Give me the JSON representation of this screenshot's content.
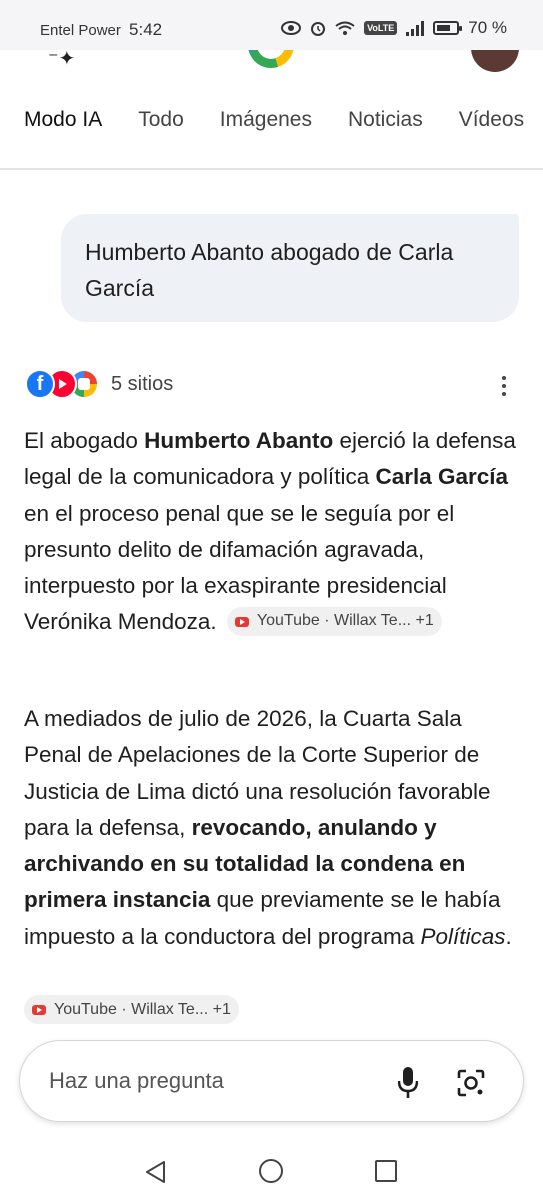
{
  "status": {
    "carrier": "Entel Power",
    "time": "5:42",
    "volte": "VoLTE",
    "battery": "70 %",
    "battery_level": 0.7
  },
  "tabs": [
    "Modo IA",
    "Todo",
    "Imágenes",
    "Noticias",
    "Vídeos"
  ],
  "query": "Humberto Abanto abogado de Carla García",
  "sources": {
    "label": "5 sitios",
    "icons": [
      "facebook-icon",
      "youtube-icon",
      "multi-source-icon"
    ]
  },
  "answer": {
    "p1": {
      "t1": "El abogado ",
      "b1": "Humberto Abanto",
      "t2": " ejerció la defensa legal de la comunicadora y política ",
      "b2": "Carla García",
      "t3": " en el proceso penal que se le seguía por el presunto delito de difamación agravada, interpuesto por la exaspirante presidencial Verónika Mendoza."
    },
    "chip1": "YouTube · Willax Te... +1",
    "p2": {
      "t1": "A mediados de julio de 2026, la Cuarta Sala Penal de Apelaciones de la Corte Superior de Justicia de Lima dictó una resolución favorable para la defensa, ",
      "b1": "revocando, anulando y archivando en su totalidad la condena en primera instancia",
      "t2": " que previamente se le había impuesto a la conductora del programa ",
      "i1": "Políticas",
      "t3": "."
    },
    "chip2": "YouTube · Willax Te... +1"
  },
  "ask": {
    "placeholder": "Haz una pregunta"
  },
  "colors": {
    "youtube": "#e53935",
    "facebook": "#1877f2",
    "query_bubble": "#eef1f6"
  }
}
